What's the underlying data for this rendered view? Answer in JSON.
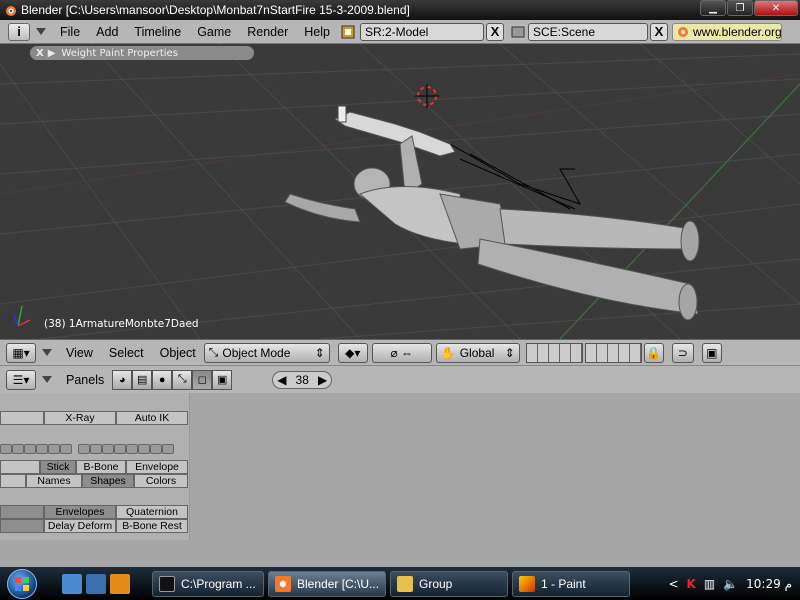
{
  "window": {
    "title": "Blender [C:\\Users\\mansoor\\Desktop\\Monbat7nStartFire 15-3-2009.blend]",
    "min_label": "▁",
    "max_label": "❐",
    "close_label": "✕"
  },
  "topmenu": {
    "info_label": "i",
    "items": [
      "File",
      "Add",
      "Timeline",
      "Game",
      "Render",
      "Help"
    ],
    "screen": "SR:2-Model",
    "scene": "SCE:Scene",
    "x_label": "X",
    "url": "www.blender.org"
  },
  "viewport": {
    "panel_label": "Weight Paint Properties",
    "panel_close": "X",
    "status": "(38) 1ArmatureMonbte7Daed",
    "background_color": "#3a3a3a"
  },
  "header3d": {
    "view": "View",
    "select": "Select",
    "object": "Object",
    "mode": "Object Mode",
    "orientation": "Global"
  },
  "buttons_header": {
    "panels_label": "Panels",
    "frame": "38"
  },
  "armature_panel": {
    "row1": [
      "X-Ray",
      "Auto IK"
    ],
    "row3": [
      "Stick",
      "B-Bone",
      "Envelope"
    ],
    "row4": [
      "Names",
      "Shapes",
      "Colors"
    ],
    "row5": [
      "Envelopes",
      "Quaternion"
    ],
    "row6": [
      "Delay Deform",
      "B-Bone Rest"
    ]
  },
  "taskbar": {
    "tasks": [
      {
        "label": "C:\\Program ...",
        "icon": "cmd-icon"
      },
      {
        "label": "Blender [C:\\U...",
        "icon": "blender-icon"
      },
      {
        "label": "Group",
        "icon": "folder-icon"
      },
      {
        "label": "1 - Paint",
        "icon": "paint-icon"
      }
    ],
    "clock": "10:29 م",
    "chevron": "<"
  }
}
